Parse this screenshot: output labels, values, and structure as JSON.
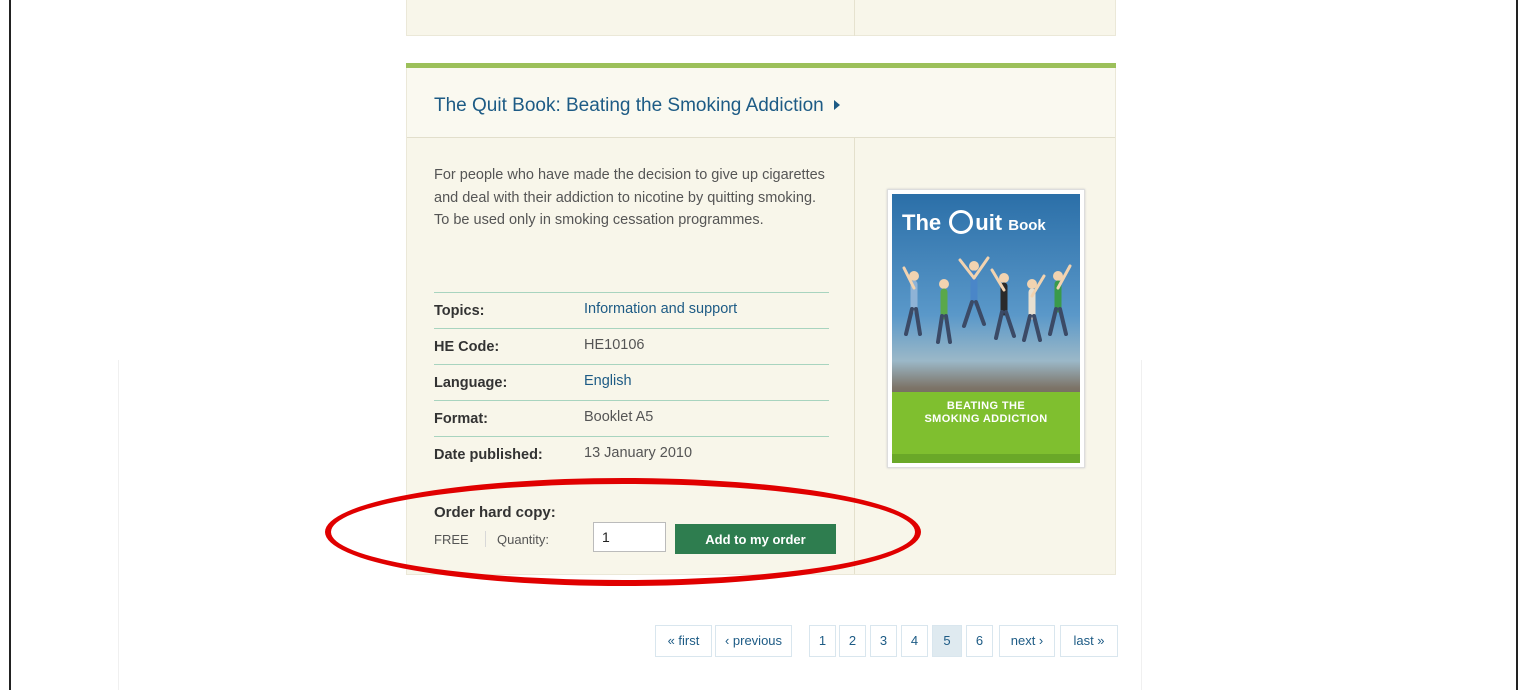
{
  "product": {
    "title": "The Quit Book: Beating the Smoking Addiction",
    "description": "For people who have made the decision to give up cigarettes and deal with their addiction to nicotine by quitting smoking. To be used only in smoking cessation programmes.",
    "meta": [
      {
        "key": "Topics:",
        "value": "Information and support",
        "is_link": true
      },
      {
        "key": "HE Code:",
        "value": "HE10106",
        "is_link": false
      },
      {
        "key": "Language:",
        "value": "English",
        "is_link": true
      },
      {
        "key": "Format:",
        "value": "Booklet A5",
        "is_link": false
      },
      {
        "key": "Date published:",
        "value": "13 January 2010",
        "is_link": false
      }
    ],
    "cover": {
      "title_left": "The",
      "title_mid": "uit",
      "title_right": "Book",
      "band_line1": "BEATING THE",
      "band_line2": "SMOKING ADDICTION",
      "band_color": "#7fbf2f"
    }
  },
  "order": {
    "title": "Order hard copy:",
    "price": "FREE",
    "quantity_label": "Quantity:",
    "quantity_value": "1",
    "add_button": "Add to my order"
  },
  "pagination": {
    "items": [
      {
        "label": "« first",
        "current": false
      },
      {
        "label": "‹ previous",
        "current": false
      },
      {
        "label": "1",
        "current": false
      },
      {
        "label": "2",
        "current": false
      },
      {
        "label": "3",
        "current": false
      },
      {
        "label": "4",
        "current": false
      },
      {
        "label": "5",
        "current": true
      },
      {
        "label": "6",
        "current": false
      },
      {
        "label": "next ›",
        "current": false
      },
      {
        "label": "last »",
        "current": false
      }
    ]
  },
  "colors": {
    "accent_green": "#9cc05a",
    "button_green": "#2e7d4f",
    "link_blue": "#1d5b85",
    "highlight_red": "#e00000"
  }
}
